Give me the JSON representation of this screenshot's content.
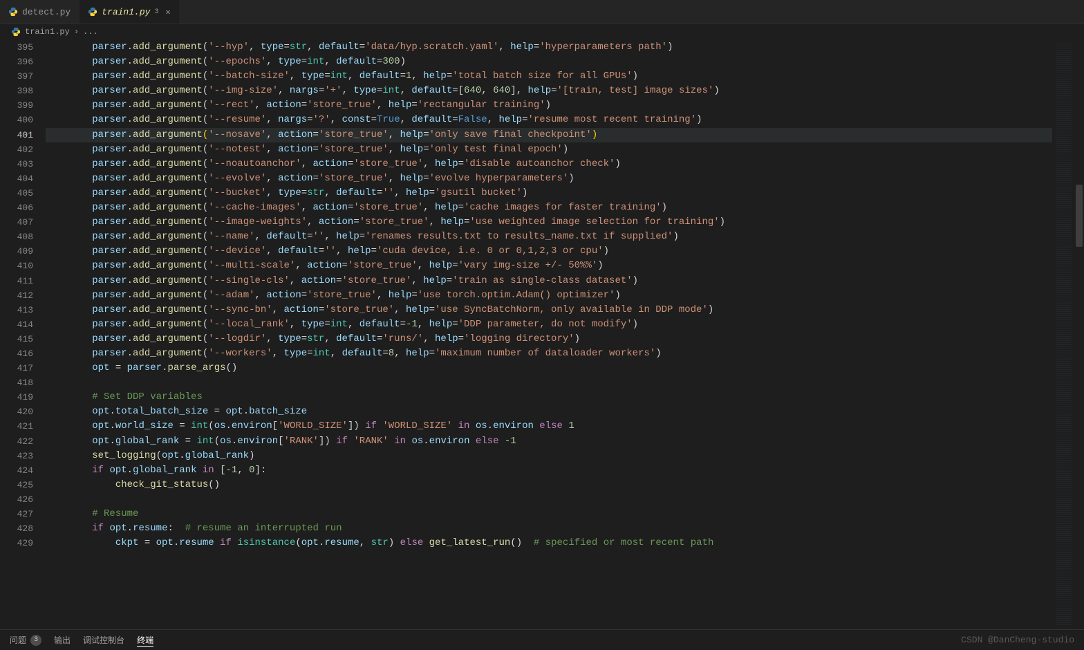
{
  "tabs": [
    {
      "name": "detect.py",
      "active": false
    },
    {
      "name": "train1.py",
      "active": true,
      "modified_badge": "3"
    }
  ],
  "breadcrumb": {
    "file": "train1.py",
    "sep": "›",
    "ellipsis": "..."
  },
  "code_start_line": 395,
  "highlighted_line": 401,
  "code_lines": [
    "        parser.add_argument('--hyp', type=str, default='data/hyp.scratch.yaml', help='hyperparameters path')",
    "        parser.add_argument('--epochs', type=int, default=300)",
    "        parser.add_argument('--batch-size', type=int, default=1, help='total batch size for all GPUs')",
    "        parser.add_argument('--img-size', nargs='+', type=int, default=[640, 640], help='[train, test] image sizes')",
    "        parser.add_argument('--rect', action='store_true', help='rectangular training')",
    "        parser.add_argument('--resume', nargs='?', const=True, default=False, help='resume most recent training')",
    "        parser.add_argument('--nosave', action='store_true', help='only save final checkpoint')",
    "        parser.add_argument('--notest', action='store_true', help='only test final epoch')",
    "        parser.add_argument('--noautoanchor', action='store_true', help='disable autoanchor check')",
    "        parser.add_argument('--evolve', action='store_true', help='evolve hyperparameters')",
    "        parser.add_argument('--bucket', type=str, default='', help='gsutil bucket')",
    "        parser.add_argument('--cache-images', action='store_true', help='cache images for faster training')",
    "        parser.add_argument('--image-weights', action='store_true', help='use weighted image selection for training')",
    "        parser.add_argument('--name', default='', help='renames results.txt to results_name.txt if supplied')",
    "        parser.add_argument('--device', default='', help='cuda device, i.e. 0 or 0,1,2,3 or cpu')",
    "        parser.add_argument('--multi-scale', action='store_true', help='vary img-size +/- 50%%')",
    "        parser.add_argument('--single-cls', action='store_true', help='train as single-class dataset')",
    "        parser.add_argument('--adam', action='store_true', help='use torch.optim.Adam() optimizer')",
    "        parser.add_argument('--sync-bn', action='store_true', help='use SyncBatchNorm, only available in DDP mode')",
    "        parser.add_argument('--local_rank', type=int, default=-1, help='DDP parameter, do not modify')",
    "        parser.add_argument('--logdir', type=str, default='runs/', help='logging directory')",
    "        parser.add_argument('--workers', type=int, default=8, help='maximum number of dataloader workers')",
    "        opt = parser.parse_args()",
    "",
    "        # Set DDP variables",
    "        opt.total_batch_size = opt.batch_size",
    "        opt.world_size = int(os.environ['WORLD_SIZE']) if 'WORLD_SIZE' in os.environ else 1",
    "        opt.global_rank = int(os.environ['RANK']) if 'RANK' in os.environ else -1",
    "        set_logging(opt.global_rank)",
    "        if opt.global_rank in [-1, 0]:",
    "            check_git_status()",
    "",
    "        # Resume",
    "        if opt.resume:  # resume an interrupted run",
    "            ckpt = opt.resume if isinstance(opt.resume, str) else get_latest_run()  # specified or most recent path"
  ],
  "panel": {
    "problems": "问题",
    "problems_count": "3",
    "output": "输出",
    "debug_console": "调试控制台",
    "terminal": "终端"
  },
  "watermark": "CSDN @DanCheng-studio"
}
